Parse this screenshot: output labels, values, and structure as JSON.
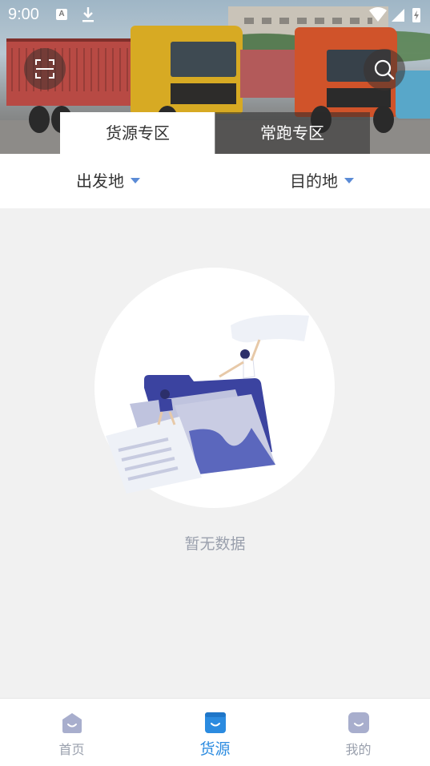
{
  "status_bar": {
    "time": "9:00",
    "keyboard_indicator": "A",
    "icons": [
      "keyboard-icon",
      "download-icon",
      "wifi-icon",
      "cell-signal-icon",
      "battery-icon"
    ]
  },
  "header": {
    "scan_icon": "scan-icon",
    "search_icon": "search-icon",
    "tabs": [
      {
        "label": "货源专区",
        "active": true
      },
      {
        "label": "常跑专区",
        "active": false
      }
    ]
  },
  "filters": {
    "origin": "出发地",
    "destination": "目的地"
  },
  "empty_state": {
    "message": "暂无数据"
  },
  "bottom_nav": {
    "items": [
      {
        "label": "首页",
        "icon": "home-icon",
        "active": false
      },
      {
        "label": "货源",
        "icon": "cargo-icon",
        "active": true
      },
      {
        "label": "我的",
        "icon": "profile-icon",
        "active": false
      }
    ]
  },
  "colors": {
    "accent": "#2b8be0",
    "inactive": "#9aa0ad",
    "caret": "#5b8bd6",
    "background": "#f1f1f1"
  }
}
